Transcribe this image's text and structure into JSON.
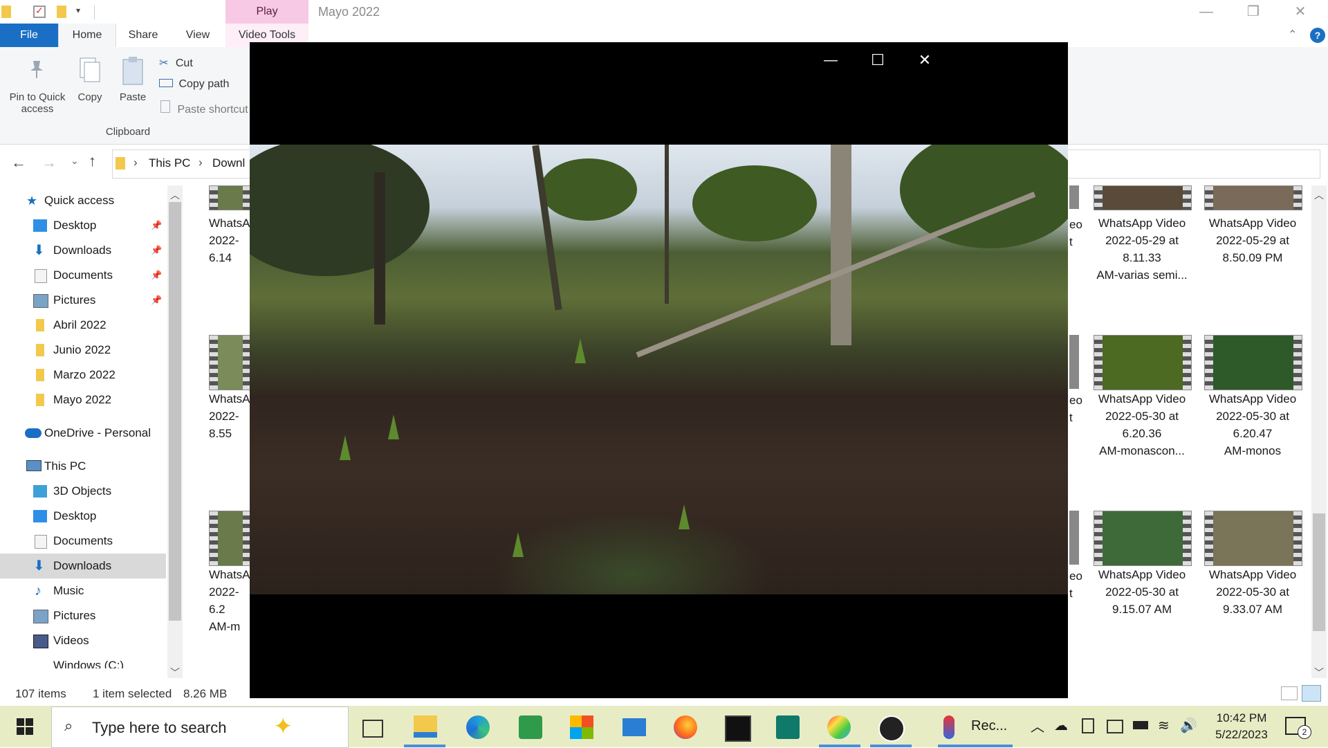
{
  "window": {
    "title": "Mayo 2022",
    "context_tab": "Play"
  },
  "ribbon": {
    "tabs": [
      "File",
      "Home",
      "Share",
      "View",
      "Video Tools"
    ],
    "pin_label_1": "Pin to Quick",
    "pin_label_2": "access",
    "copy_label": "Copy",
    "paste_label": "Paste",
    "cut_label": "Cut",
    "copy_path_label": "Copy path",
    "paste_shortcut_label": "Paste shortcut",
    "group_clipboard": "Clipboard"
  },
  "address": {
    "crumbs": [
      "This PC",
      "Downl"
    ]
  },
  "nav": {
    "quick_access": "Quick access",
    "pinned": [
      "Desktop",
      "Downloads",
      "Documents",
      "Pictures"
    ],
    "folders": [
      "Abril 2022",
      "Junio 2022",
      "Marzo 2022",
      "Mayo 2022"
    ],
    "onedrive": "OneDrive - Personal",
    "this_pc": "This PC",
    "pc_items": [
      "3D Objects",
      "Desktop",
      "Documents",
      "Downloads",
      "Music",
      "Pictures",
      "Videos",
      "Windows (C:)"
    ]
  },
  "files": {
    "left_col": [
      [
        "WhatsA",
        "2022-",
        "6.14"
      ],
      [
        "WhatsA",
        "2022-",
        "8.55"
      ],
      [
        "WhatsA",
        "2022-",
        "6.2",
        "AM-m"
      ]
    ],
    "partial_col": [
      "eo",
      "t"
    ],
    "col_a": [
      [
        "WhatsApp Video",
        "2022-05-29 at",
        "8.11.33",
        "AM-varias semi..."
      ],
      [
        "WhatsApp Video",
        "2022-05-30 at",
        "6.20.36",
        "AM-monascon..."
      ],
      [
        "WhatsApp Video",
        "2022-05-30 at",
        "9.15.07 AM"
      ]
    ],
    "col_b": [
      [
        "WhatsApp Video",
        "2022-05-29 at",
        "8.50.09 PM"
      ],
      [
        "WhatsApp Video",
        "2022-05-30 at",
        "6.20.47",
        "AM-monos"
      ],
      [
        "WhatsApp Video",
        "2022-05-30 at",
        "9.33.07 AM"
      ]
    ]
  },
  "status": {
    "count": "107 items",
    "selected": "1 item selected",
    "size": "8.26 MB"
  },
  "taskbar": {
    "search_placeholder": "Type here to search",
    "running_label": "Rec...",
    "time": "10:42 PM",
    "date": "5/22/2023",
    "notif_count": "2"
  },
  "colors": {
    "accent": "#1a6fc4",
    "taskbar": "#e8ecc4",
    "play_tab": "#f7c9e4"
  }
}
